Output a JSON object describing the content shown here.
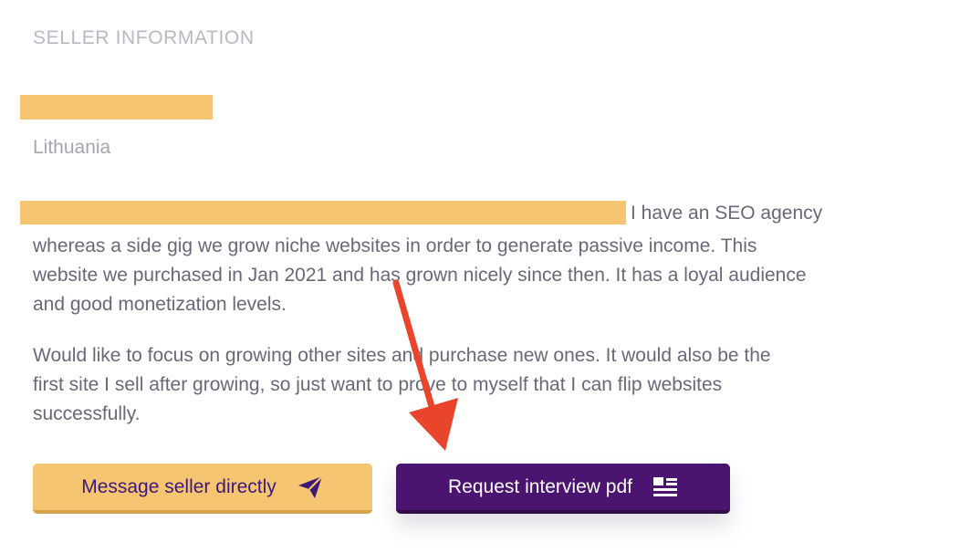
{
  "seller": {
    "section_title": "SELLER INFORMATION",
    "location": "Lithuania",
    "bio_line1_tail": "I have an SEO agency",
    "bio_paragraph1_lines": [
      "whereas a side gig we grow niche websites in order to generate passive income. This",
      "website we purchased in Jan 2021 and has grown nicely since then. It has a loyal audience",
      "and good monetization levels."
    ],
    "bio_paragraph2_lines": [
      "Would like to focus on growing other sites and purchase new ones. It would also be the",
      "first site I sell after growing, so just want to prove to myself that I can flip websites",
      "successfully."
    ]
  },
  "actions": {
    "message_label": "Message seller directly",
    "message_icon": "send-icon",
    "request_label": "Request interview pdf",
    "request_icon": "document-list-icon"
  },
  "colors": {
    "redaction": "#f5c571",
    "primary_button": "#4b1470",
    "secondary_button": "#f5c571",
    "annotation_arrow": "#e8452c"
  }
}
